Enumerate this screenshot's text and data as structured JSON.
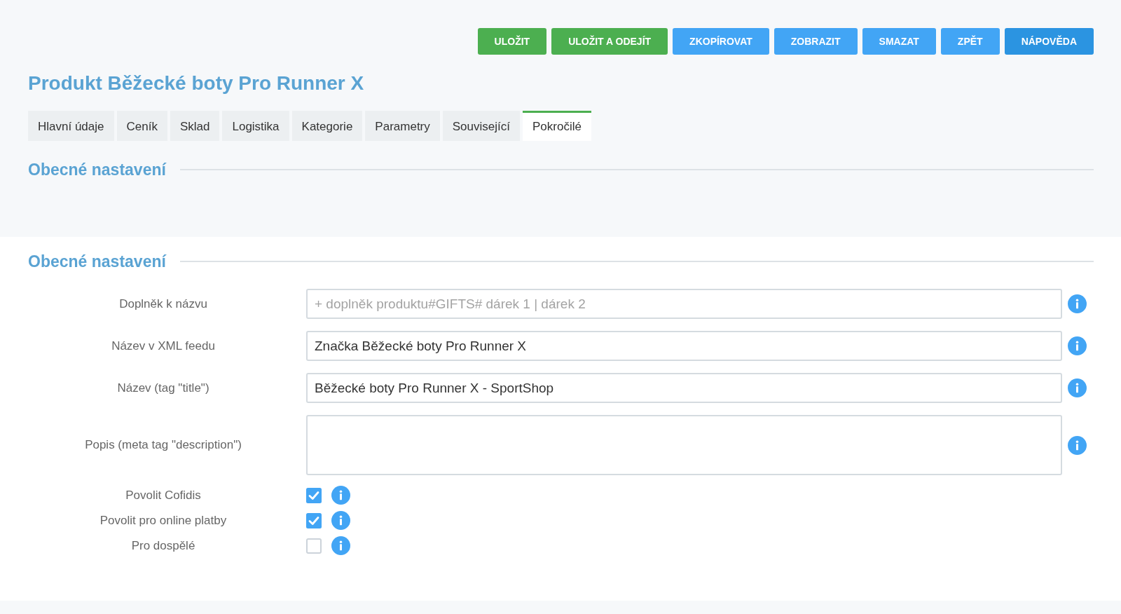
{
  "toolbar": {
    "buttons": [
      {
        "label": "ULOŽIT",
        "kind": "success"
      },
      {
        "label": "ULOŽIT A ODEJÍT",
        "kind": "success"
      },
      {
        "label": "ZKOPÍROVAT",
        "kind": "primary"
      },
      {
        "label": "ZOBRAZIT",
        "kind": "primary"
      },
      {
        "label": "SMAZAT",
        "kind": "primary"
      },
      {
        "label": "ZPĚT",
        "kind": "primary"
      },
      {
        "label": "NÁPOVĚDA",
        "kind": "help"
      }
    ]
  },
  "title": "Produkt Běžecké boty Pro Runner X",
  "tabs": [
    {
      "label": "Hlavní údaje",
      "selected": false
    },
    {
      "label": "Ceník",
      "selected": false
    },
    {
      "label": "Sklad",
      "selected": false
    },
    {
      "label": "Logistika",
      "selected": false
    },
    {
      "label": "Kategorie",
      "selected": false
    },
    {
      "label": "Parametry",
      "selected": false
    },
    {
      "label": "Související",
      "selected": false
    },
    {
      "label": "Pokročilé",
      "selected": true
    }
  ],
  "sections": [
    {
      "heading": "Obecné nastavení"
    },
    {
      "heading": "Obecné nastavení",
      "fields": [
        {
          "kind": "text",
          "label": "Doplněk k názvu",
          "placeholder": "+ doplněk produktu#GIFTS# dárek 1 | dárek 2"
        },
        {
          "kind": "text",
          "label": "Název v XML feedu",
          "value": "Značka Běžecké boty Pro Runner X"
        },
        {
          "kind": "text",
          "label": "Název (tag \"title\")",
          "value": "Běžecké boty Pro Runner X - SportShop"
        },
        {
          "kind": "textarea",
          "label": "Popis (meta tag \"description\")"
        },
        {
          "kind": "checkbox",
          "label": "Povolit Cofidis",
          "checked": true
        },
        {
          "kind": "checkbox",
          "label": "Povolit pro online platby",
          "checked": true
        },
        {
          "kind": "checkbox",
          "label": "Pro dospělé",
          "checked": false
        }
      ]
    }
  ]
}
